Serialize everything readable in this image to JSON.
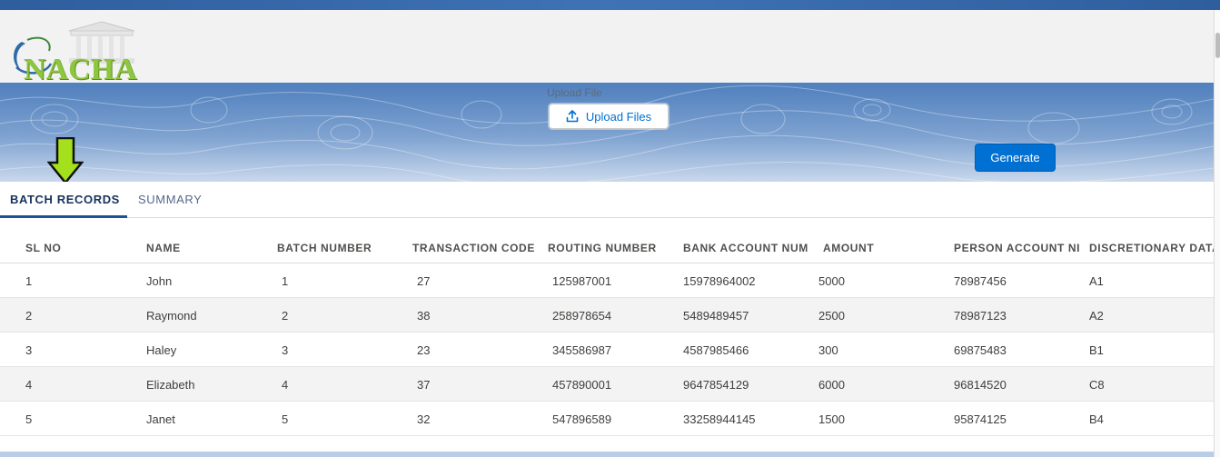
{
  "app": {
    "logo_text": "NACHA"
  },
  "upload": {
    "label": "Upload File",
    "button_label": "Upload Files",
    "icon": "upload-icon"
  },
  "actions": {
    "generate_label": "Generate"
  },
  "tabs": [
    {
      "label": "BATCH RECORDS",
      "active": true
    },
    {
      "label": "SUMMARY",
      "active": false
    }
  ],
  "table": {
    "columns": [
      "SL NO",
      "NAME",
      "BATCH NUMBER",
      "TRANSACTION CODE",
      "ROUTING NUMBER",
      "BANK ACCOUNT NUM",
      "AMOUNT",
      "PERSON ACCOUNT NI",
      "DISCRETIONARY DATA"
    ],
    "rows": [
      [
        "1",
        "John",
        "1",
        "27",
        "125987001",
        "15978964002",
        "5000",
        "78987456",
        "A1"
      ],
      [
        "2",
        "Raymond",
        "2",
        "38",
        "258978654",
        "5489489457",
        "2500",
        "78987123",
        "A2"
      ],
      [
        "3",
        "Haley",
        "3",
        "23",
        "345586987",
        "4587985466",
        "300",
        "69875483",
        "B1"
      ],
      [
        "4",
        "Elizabeth",
        "4",
        "37",
        "457890001",
        "9647854129",
        "6000",
        "96814520",
        "C8"
      ],
      [
        "5",
        "Janet",
        "5",
        "32",
        "547896589",
        "33258944145",
        "1500",
        "95874125",
        "B4"
      ]
    ]
  },
  "colors": {
    "accent": "#0070d2",
    "arrow": "#a4e01c",
    "logo_green": "#8dc63f"
  }
}
